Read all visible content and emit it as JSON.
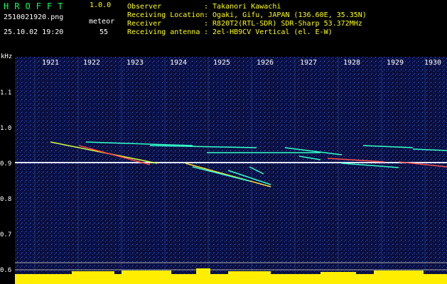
{
  "header": {
    "app_title": "HROFFT",
    "app_version": "1.0.0",
    "filename": "2510021920.png",
    "datetime": "25.10.02 19:20",
    "meteor_label": "meteor",
    "meteor_count": "55"
  },
  "info": {
    "observer_label": "Observer",
    "observer_value": ": Takanori Kawachi",
    "location_label": "Receiving Location",
    "location_value": ": Ogaki, Gifu, JAPAN (136.60E, 35.35N)",
    "receiver_label": "Receiver",
    "receiver_value": ": R820T2(RTL-SDR) SDR-Sharp 53.372MHz",
    "antenna_label": "Receiving antenna",
    "antenna_value": ": 2el-HB9CV Vertical (el. E-W)"
  },
  "axis": {
    "unit_label": "kHz",
    "time_ticks": [
      "1921",
      "1922",
      "1923",
      "1924",
      "1925",
      "1926",
      "1927",
      "1928",
      "1929",
      "1930"
    ],
    "freq_ticks": [
      "1.1",
      "1.0",
      "0.9",
      "0.8",
      "0.7",
      "0.6"
    ]
  },
  "colors": {
    "background": "#0a0f40",
    "carrier": "#ffffff",
    "trail": "#33ffcc",
    "bars": "#ffee00",
    "title": "#00ff66",
    "info": "#ffff00"
  }
}
